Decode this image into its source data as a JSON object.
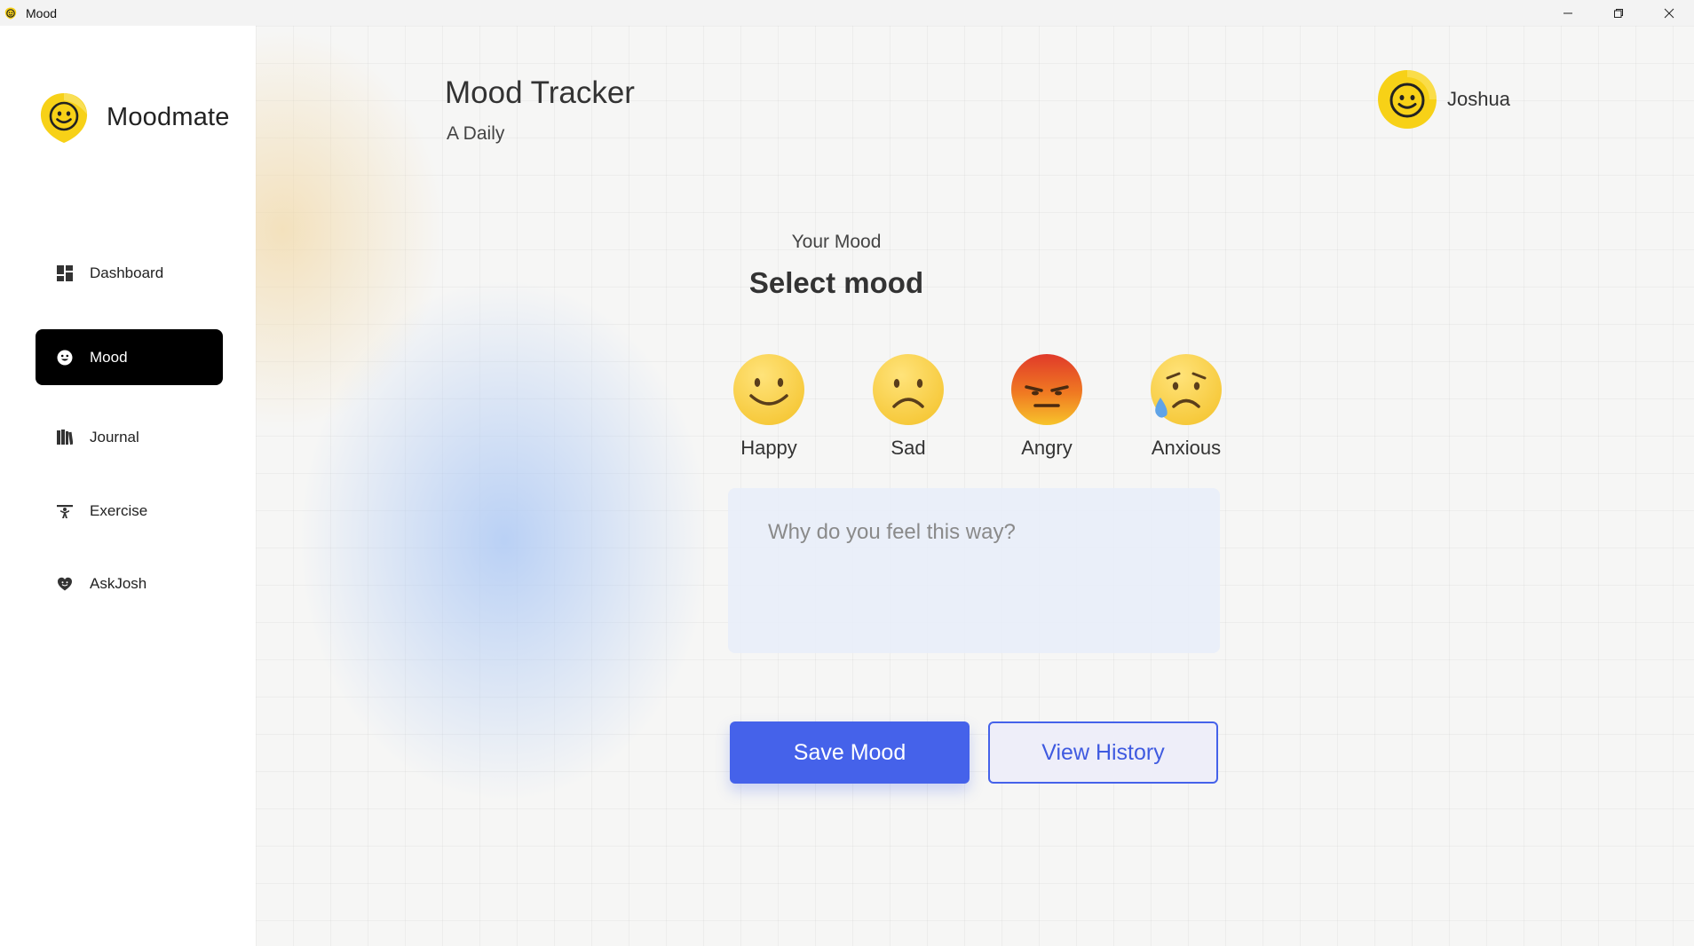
{
  "window": {
    "title": "Mood",
    "controls": [
      "minimize-icon",
      "restore-icon",
      "close-icon"
    ]
  },
  "sidebar": {
    "brand": "Moodmate",
    "items": [
      {
        "label": "Dashboard",
        "icon": "dashboard-icon",
        "active": false
      },
      {
        "label": "Mood",
        "icon": "smiley-icon",
        "active": true
      },
      {
        "label": "Journal",
        "icon": "journal-icon",
        "active": false
      },
      {
        "label": "Exercise",
        "icon": "exercise-icon",
        "active": false
      },
      {
        "label": "AskJosh",
        "icon": "heart-chat-icon",
        "active": false
      }
    ]
  },
  "header": {
    "title": "Mood Tracker",
    "subtitle": "A Daily",
    "user_name": "Joshua"
  },
  "mood": {
    "label": "Your Mood",
    "heading": "Select mood",
    "options": [
      {
        "label": "Happy",
        "icon": "happy-emoji"
      },
      {
        "label": "Sad",
        "icon": "sad-emoji"
      },
      {
        "label": "Angry",
        "icon": "angry-emoji"
      },
      {
        "label": "Anxious",
        "icon": "anxious-emoji"
      }
    ],
    "reason_placeholder": "Why do you feel this way?",
    "reason_value": ""
  },
  "actions": {
    "save_label": "Save Mood",
    "history_label": "View History"
  },
  "colors": {
    "primary": "#4562ea",
    "active_nav": "#000000",
    "brand_yellow": "#f7d117"
  }
}
